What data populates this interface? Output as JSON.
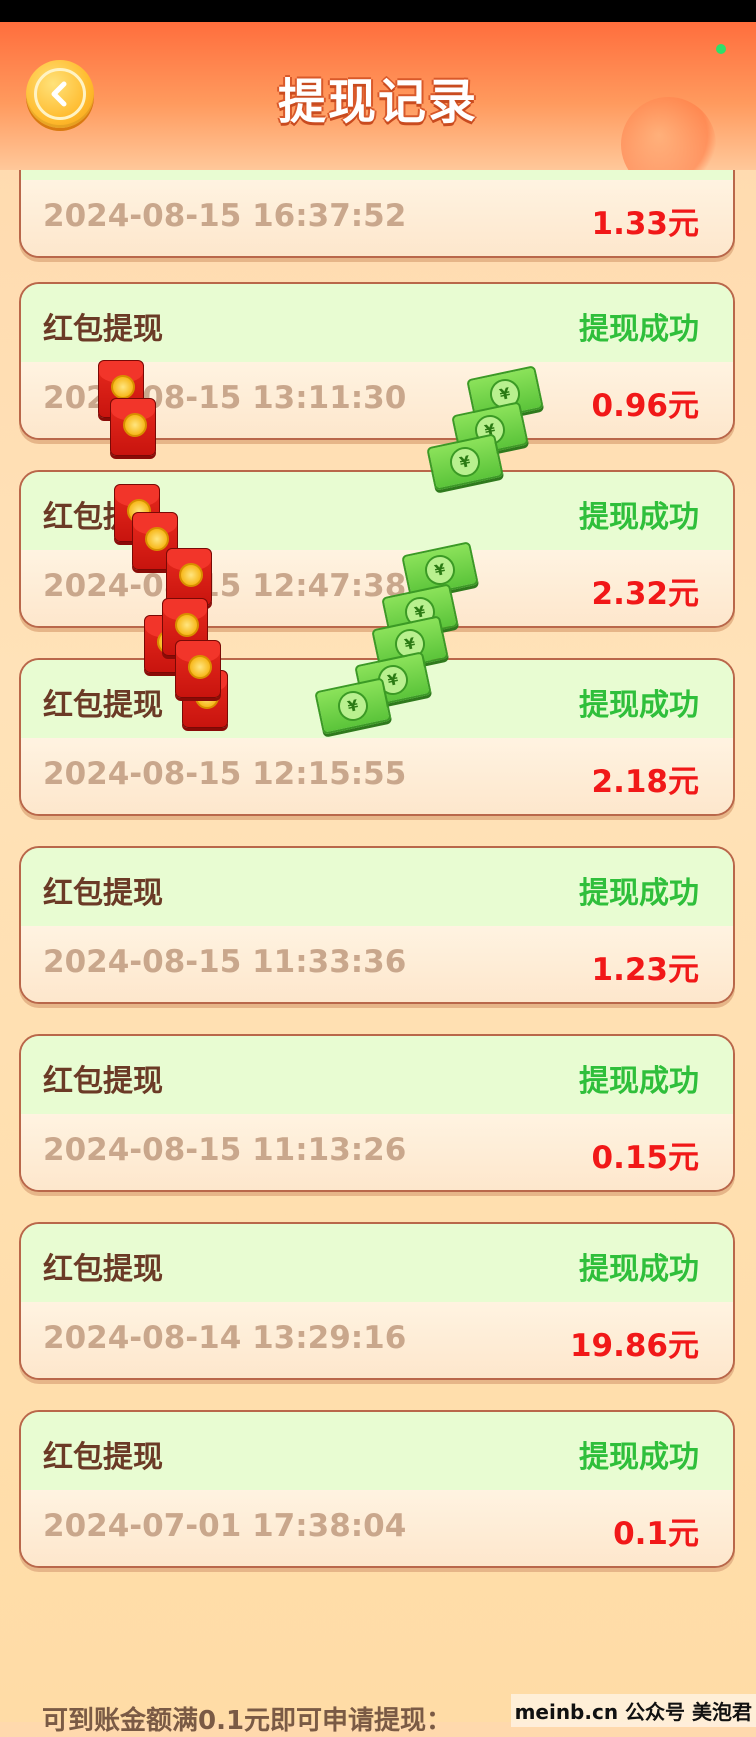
{
  "header": {
    "title": "提现记录",
    "back_label": "返回"
  },
  "records": [
    {
      "type": "",
      "status": "",
      "time": "2024-08-15 16:37:52",
      "amount": "1.33元"
    },
    {
      "type": "红包提现",
      "status": "提现成功",
      "time": "2024-08-15 13:11:30",
      "amount": "0.96元"
    },
    {
      "type": "红包提现",
      "status": "提现成功",
      "time": "2024-08-15 12:47:38",
      "amount": "2.32元"
    },
    {
      "type": "红包提现",
      "status": "提现成功",
      "time": "2024-08-15 12:15:55",
      "amount": "2.18元"
    },
    {
      "type": "红包提现",
      "status": "提现成功",
      "time": "2024-08-15 11:33:36",
      "amount": "1.23元"
    },
    {
      "type": "红包提现",
      "status": "提现成功",
      "time": "2024-08-15 11:13:26",
      "amount": "0.15元"
    },
    {
      "type": "红包提现",
      "status": "提现成功",
      "time": "2024-08-14 13:29:16",
      "amount": "19.86元"
    },
    {
      "type": "红包提现",
      "status": "提现成功",
      "time": "2024-07-01 17:38:04",
      "amount": "0.1元"
    }
  ],
  "footer": {
    "note": "可到账金额满0.1元即可申请提现：",
    "watermark": "meinb.cn 公众号 美泡君"
  },
  "colors": {
    "header_orange": "#ff6e3d",
    "status_green": "#2fbf3b",
    "amount_red": "#f11818",
    "card_top_green": "#e8fcd2"
  }
}
